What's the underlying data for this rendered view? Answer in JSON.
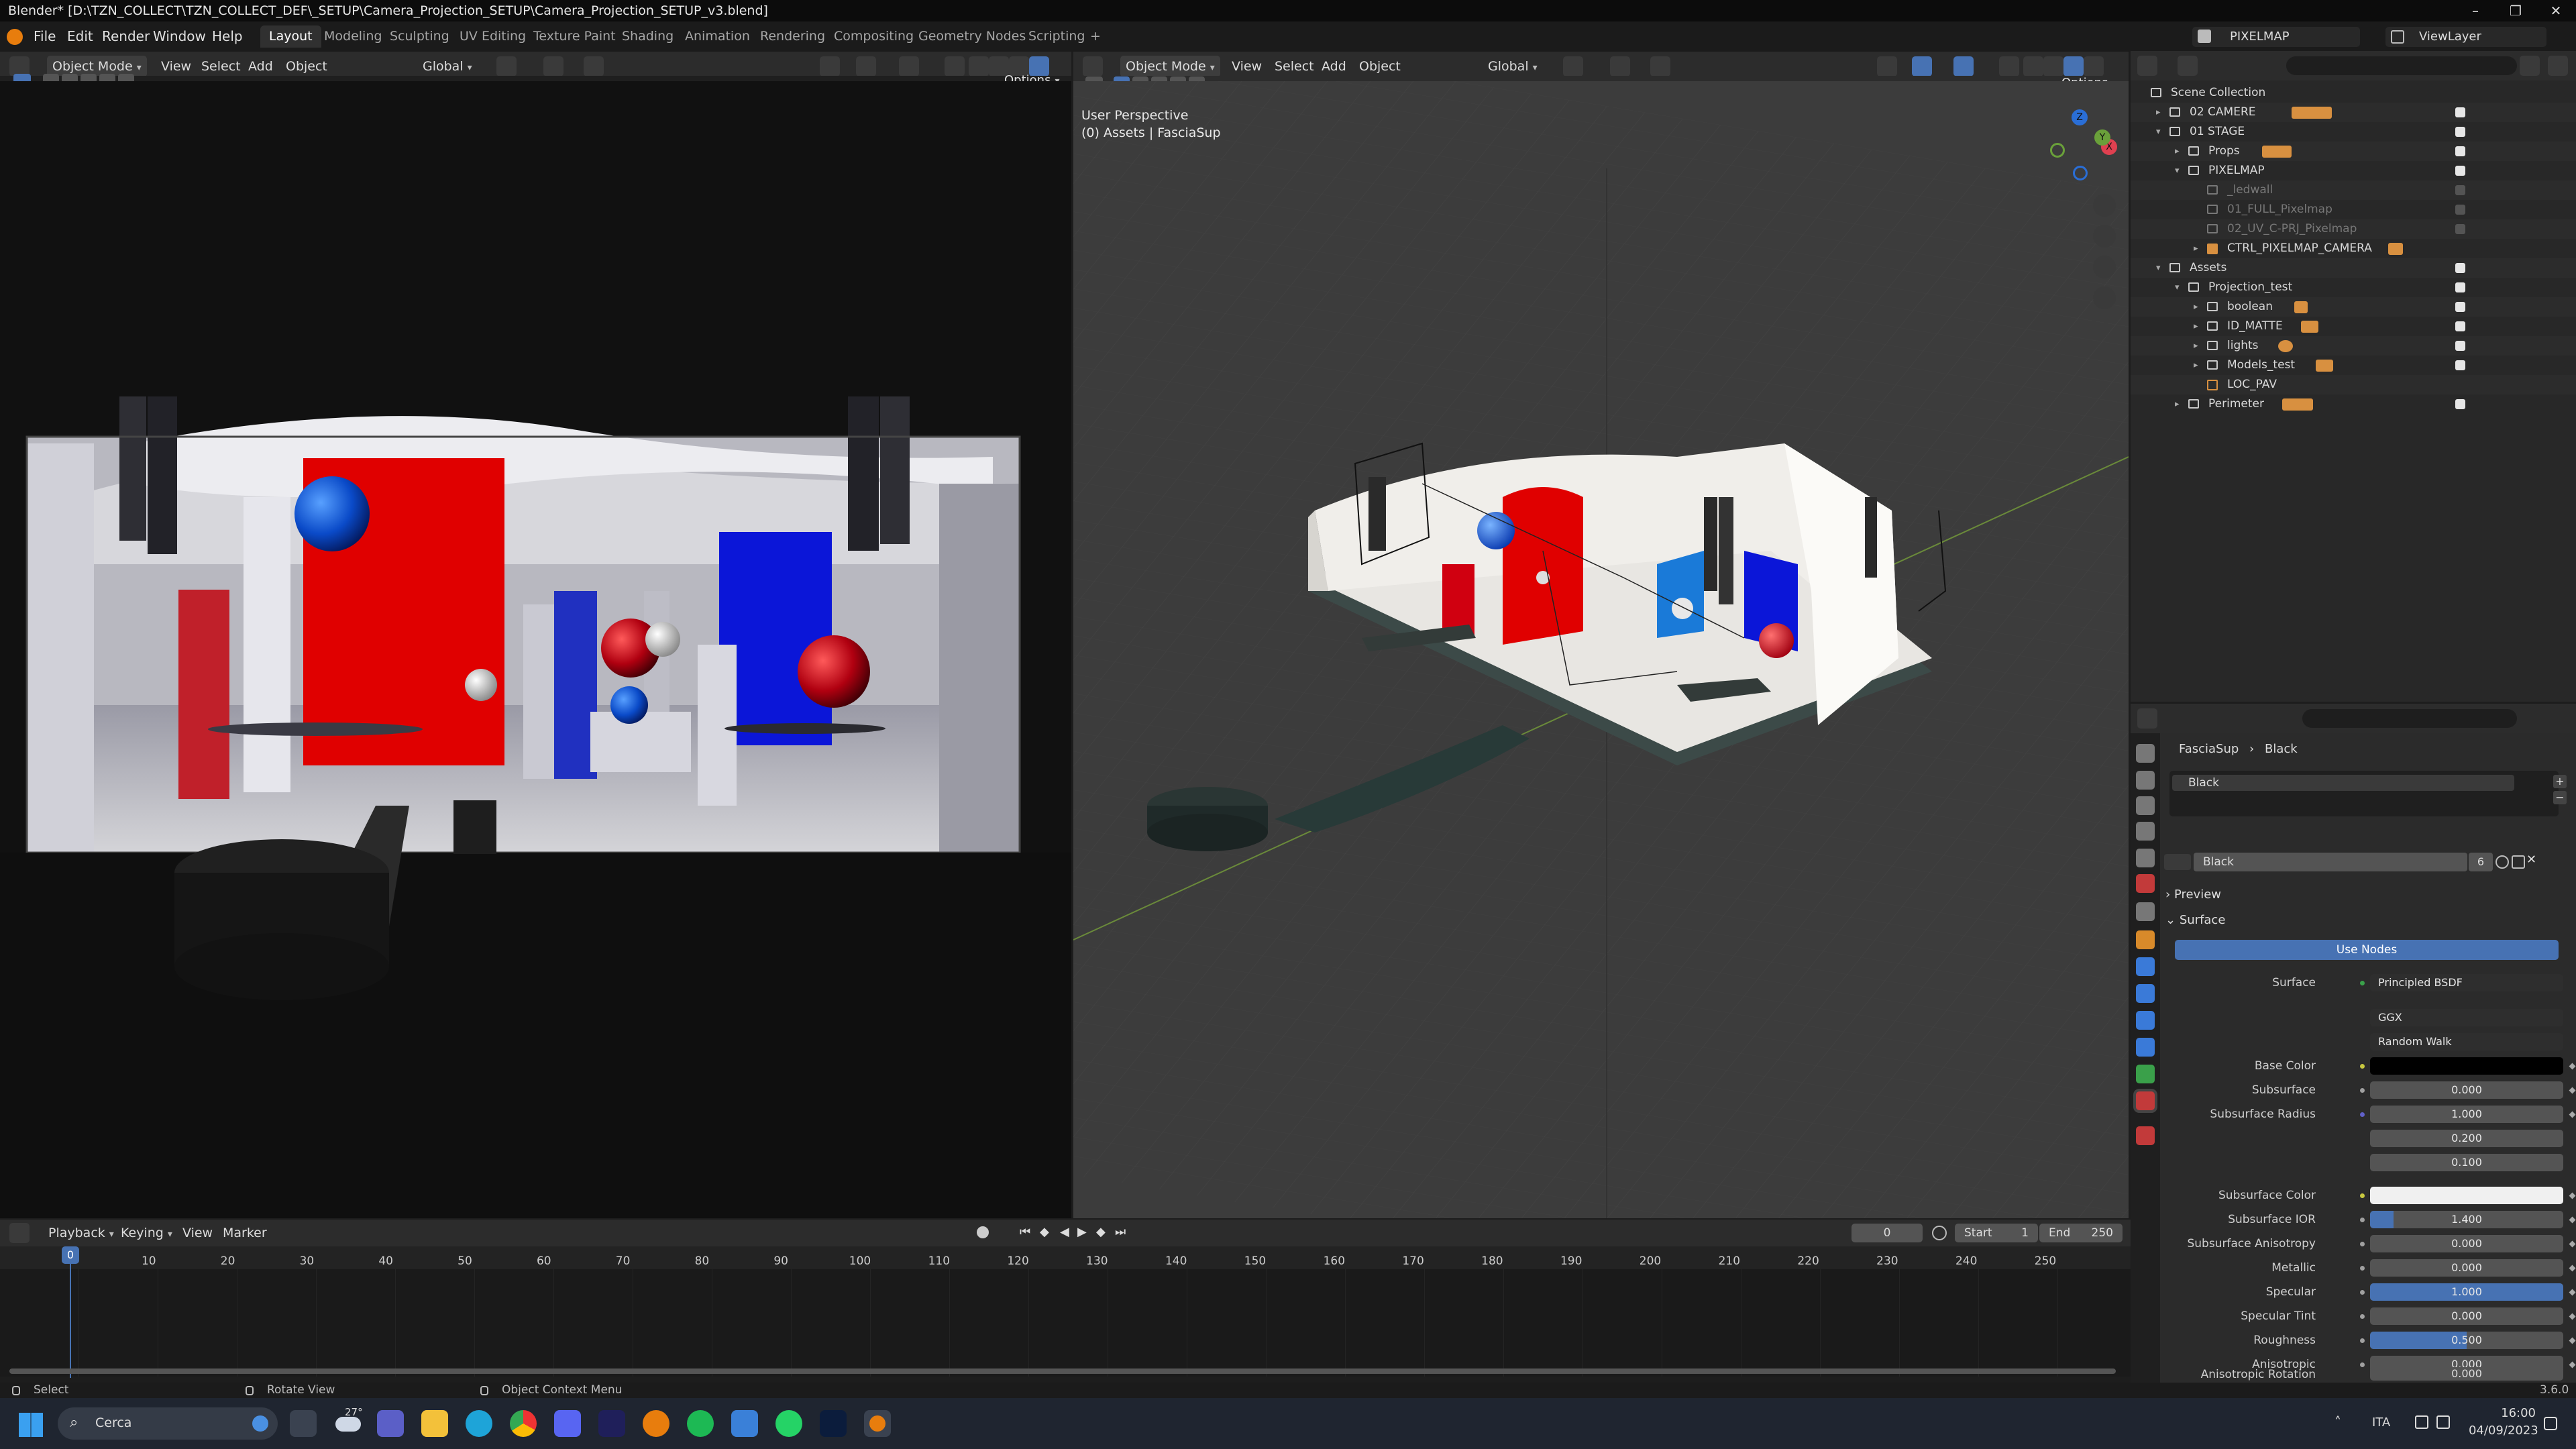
{
  "window": {
    "title": "Blender* [D:\\TZN_COLLECT\\TZN_COLLECT_DEF\\_SETUP\\Camera_Projection_SETUP\\Camera_Projection_SETUP_v3.blend]"
  },
  "menu": [
    "File",
    "Edit",
    "Render",
    "Window",
    "Help"
  ],
  "workspaces": [
    "Layout",
    "Modeling",
    "Sculpting",
    "UV Editing",
    "Texture Paint",
    "Shading",
    "Animation",
    "Rendering",
    "Compositing",
    "Geometry Nodes",
    "Scripting"
  ],
  "workspace_add": "+",
  "top_right": {
    "scene": "PIXELMAP",
    "view_layer": "ViewLayer"
  },
  "viewport_header": {
    "mode": "Object Mode",
    "view": "View",
    "select": "Select",
    "add": "Add",
    "object": "Object",
    "orientation": "Global",
    "options": "Options"
  },
  "right_viewport": {
    "line1": "User Perspective",
    "line2": "(0) Assets | FasciaSup"
  },
  "gizmo_axes": {
    "x": "X",
    "y": "Y",
    "z": "Z"
  },
  "outliner": {
    "search_placeholder": "",
    "rows": [
      {
        "label": "Scene Collection"
      },
      {
        "label": "02 CAMERE"
      },
      {
        "label": "01 STAGE"
      },
      {
        "label": "Props"
      },
      {
        "label": "PIXELMAP"
      },
      {
        "label": "_ledwall"
      },
      {
        "label": "01_FULL_Pixelmap"
      },
      {
        "label": "02_UV_C-PRJ_Pixelmap"
      },
      {
        "label": "CTRL_PIXELMAP_CAMERA"
      },
      {
        "label": "Assets"
      },
      {
        "label": "Projection_test"
      },
      {
        "label": "boolean"
      },
      {
        "label": "ID_MATTE"
      },
      {
        "label": "lights"
      },
      {
        "label": "Models_test"
      },
      {
        "label": "LOC_PAV"
      },
      {
        "label": "Perimeter"
      }
    ]
  },
  "properties": {
    "breadcrumb_object": "FasciaSup",
    "breadcrumb_material": "Black",
    "slot": "Black",
    "material_name": "Black",
    "users": "6",
    "preview": "Preview",
    "surface_panel": "Surface",
    "use_nodes": "Use Nodes",
    "surface_label": "Surface",
    "surface_shader": "Principled BSDF",
    "distribution": "GGX",
    "subsurface_method": "Random Walk",
    "fields": [
      {
        "label": "Base Color",
        "value": ""
      },
      {
        "label": "Subsurface",
        "value": "0.000"
      },
      {
        "label": "Subsurface Radius",
        "value": "1.000"
      },
      {
        "label": "",
        "value": "0.200"
      },
      {
        "label": "",
        "value": "0.100"
      },
      {
        "label": "Subsurface Color",
        "value": ""
      },
      {
        "label": "Subsurface IOR",
        "value": "1.400"
      },
      {
        "label": "Subsurface Anisotropy",
        "value": "0.000"
      },
      {
        "label": "Metallic",
        "value": "0.000"
      },
      {
        "label": "Specular",
        "value": "1.000"
      },
      {
        "label": "Specular Tint",
        "value": "0.000"
      },
      {
        "label": "Roughness",
        "value": "0.500"
      },
      {
        "label": "Anisotropic",
        "value": "0.000"
      },
      {
        "label": "Anisotropic Rotation",
        "value": "0.000"
      }
    ]
  },
  "timeline": {
    "playback": "Playback",
    "keying": "Keying",
    "view": "View",
    "marker": "Marker",
    "current_frame": "0",
    "start_label": "Start",
    "start": "1",
    "end_label": "End",
    "end": "250",
    "playhead": "0",
    "ticks": [
      "10",
      "20",
      "30",
      "40",
      "50",
      "60",
      "70",
      "80",
      "90",
      "100",
      "110",
      "120",
      "130",
      "140",
      "150",
      "160",
      "170",
      "180",
      "190",
      "200",
      "210",
      "220",
      "230",
      "240",
      "250"
    ]
  },
  "status": {
    "select": "Select",
    "rotate": "Rotate View",
    "context": "Object Context Menu",
    "version": "3.6.0"
  },
  "taskbar": {
    "search": "Cerca",
    "weather": "27°",
    "lang": "ITA",
    "time": "16:00",
    "date": "04/09/2023"
  },
  "colors": {
    "accent": "#4772b3",
    "red": "#e00000",
    "blue": "#0b16d8",
    "bg": "#1d1d1d"
  }
}
